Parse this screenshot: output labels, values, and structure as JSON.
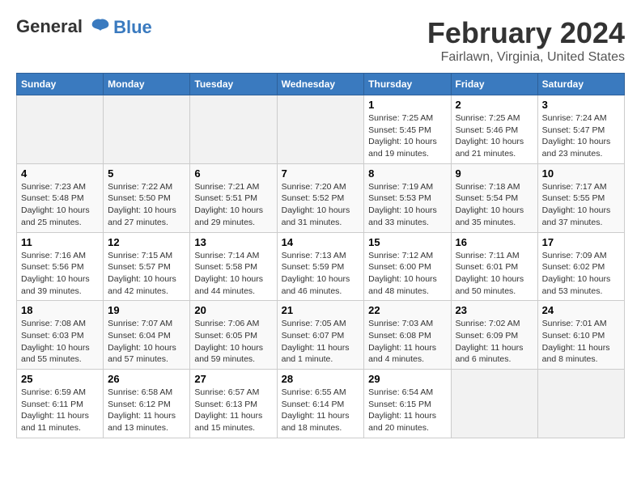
{
  "header": {
    "logo_line1": "General",
    "logo_line2": "Blue",
    "title": "February 2024",
    "subtitle": "Fairlawn, Virginia, United States"
  },
  "days_of_week": [
    "Sunday",
    "Monday",
    "Tuesday",
    "Wednesday",
    "Thursday",
    "Friday",
    "Saturday"
  ],
  "weeks": [
    [
      {
        "day": "",
        "info": ""
      },
      {
        "day": "",
        "info": ""
      },
      {
        "day": "",
        "info": ""
      },
      {
        "day": "",
        "info": ""
      },
      {
        "day": "1",
        "info": "Sunrise: 7:25 AM\nSunset: 5:45 PM\nDaylight: 10 hours and 19 minutes."
      },
      {
        "day": "2",
        "info": "Sunrise: 7:25 AM\nSunset: 5:46 PM\nDaylight: 10 hours and 21 minutes."
      },
      {
        "day": "3",
        "info": "Sunrise: 7:24 AM\nSunset: 5:47 PM\nDaylight: 10 hours and 23 minutes."
      }
    ],
    [
      {
        "day": "4",
        "info": "Sunrise: 7:23 AM\nSunset: 5:48 PM\nDaylight: 10 hours and 25 minutes."
      },
      {
        "day": "5",
        "info": "Sunrise: 7:22 AM\nSunset: 5:50 PM\nDaylight: 10 hours and 27 minutes."
      },
      {
        "day": "6",
        "info": "Sunrise: 7:21 AM\nSunset: 5:51 PM\nDaylight: 10 hours and 29 minutes."
      },
      {
        "day": "7",
        "info": "Sunrise: 7:20 AM\nSunset: 5:52 PM\nDaylight: 10 hours and 31 minutes."
      },
      {
        "day": "8",
        "info": "Sunrise: 7:19 AM\nSunset: 5:53 PM\nDaylight: 10 hours and 33 minutes."
      },
      {
        "day": "9",
        "info": "Sunrise: 7:18 AM\nSunset: 5:54 PM\nDaylight: 10 hours and 35 minutes."
      },
      {
        "day": "10",
        "info": "Sunrise: 7:17 AM\nSunset: 5:55 PM\nDaylight: 10 hours and 37 minutes."
      }
    ],
    [
      {
        "day": "11",
        "info": "Sunrise: 7:16 AM\nSunset: 5:56 PM\nDaylight: 10 hours and 39 minutes."
      },
      {
        "day": "12",
        "info": "Sunrise: 7:15 AM\nSunset: 5:57 PM\nDaylight: 10 hours and 42 minutes."
      },
      {
        "day": "13",
        "info": "Sunrise: 7:14 AM\nSunset: 5:58 PM\nDaylight: 10 hours and 44 minutes."
      },
      {
        "day": "14",
        "info": "Sunrise: 7:13 AM\nSunset: 5:59 PM\nDaylight: 10 hours and 46 minutes."
      },
      {
        "day": "15",
        "info": "Sunrise: 7:12 AM\nSunset: 6:00 PM\nDaylight: 10 hours and 48 minutes."
      },
      {
        "day": "16",
        "info": "Sunrise: 7:11 AM\nSunset: 6:01 PM\nDaylight: 10 hours and 50 minutes."
      },
      {
        "day": "17",
        "info": "Sunrise: 7:09 AM\nSunset: 6:02 PM\nDaylight: 10 hours and 53 minutes."
      }
    ],
    [
      {
        "day": "18",
        "info": "Sunrise: 7:08 AM\nSunset: 6:03 PM\nDaylight: 10 hours and 55 minutes."
      },
      {
        "day": "19",
        "info": "Sunrise: 7:07 AM\nSunset: 6:04 PM\nDaylight: 10 hours and 57 minutes."
      },
      {
        "day": "20",
        "info": "Sunrise: 7:06 AM\nSunset: 6:05 PM\nDaylight: 10 hours and 59 minutes."
      },
      {
        "day": "21",
        "info": "Sunrise: 7:05 AM\nSunset: 6:07 PM\nDaylight: 11 hours and 1 minute."
      },
      {
        "day": "22",
        "info": "Sunrise: 7:03 AM\nSunset: 6:08 PM\nDaylight: 11 hours and 4 minutes."
      },
      {
        "day": "23",
        "info": "Sunrise: 7:02 AM\nSunset: 6:09 PM\nDaylight: 11 hours and 6 minutes."
      },
      {
        "day": "24",
        "info": "Sunrise: 7:01 AM\nSunset: 6:10 PM\nDaylight: 11 hours and 8 minutes."
      }
    ],
    [
      {
        "day": "25",
        "info": "Sunrise: 6:59 AM\nSunset: 6:11 PM\nDaylight: 11 hours and 11 minutes."
      },
      {
        "day": "26",
        "info": "Sunrise: 6:58 AM\nSunset: 6:12 PM\nDaylight: 11 hours and 13 minutes."
      },
      {
        "day": "27",
        "info": "Sunrise: 6:57 AM\nSunset: 6:13 PM\nDaylight: 11 hours and 15 minutes."
      },
      {
        "day": "28",
        "info": "Sunrise: 6:55 AM\nSunset: 6:14 PM\nDaylight: 11 hours and 18 minutes."
      },
      {
        "day": "29",
        "info": "Sunrise: 6:54 AM\nSunset: 6:15 PM\nDaylight: 11 hours and 20 minutes."
      },
      {
        "day": "",
        "info": ""
      },
      {
        "day": "",
        "info": ""
      }
    ]
  ]
}
